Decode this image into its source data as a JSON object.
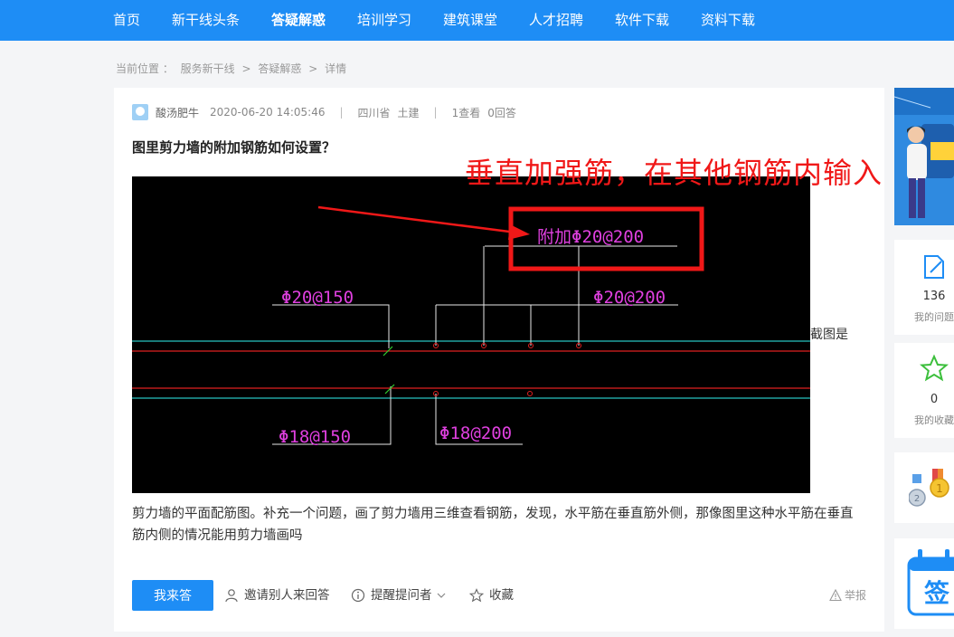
{
  "nav": {
    "items": [
      {
        "label": "首页",
        "active": false
      },
      {
        "label": "新干线头条",
        "active": false
      },
      {
        "label": "答疑解惑",
        "active": true
      },
      {
        "label": "培训学习",
        "active": false
      },
      {
        "label": "建筑课堂",
        "active": false
      },
      {
        "label": "人才招聘",
        "active": false
      },
      {
        "label": "软件下载",
        "active": false
      },
      {
        "label": "资料下载",
        "active": false
      }
    ]
  },
  "breadcrumb": {
    "prefix": "当前位置 ：",
    "items": [
      "服务新干线",
      "答疑解惑",
      "详情"
    ],
    "separator": ">"
  },
  "question": {
    "author": "酸汤肥牛",
    "datetime": "2020-06-20 14:05:46",
    "region": "四川省",
    "category": "土建",
    "views": "1查看",
    "answers": "0回答",
    "title": "图里剪力墙的附加钢筋如何设置？",
    "annotation": "垂直加强筋，在其他钢筋内输入",
    "side_text": "截图是",
    "body": "剪力墙的平面配筋图。补充一个问题，画了剪力墙用三维查看钢筋，发现，水平筋在垂直筋外侧，那像图里这种水平筋在垂直筋内侧的情况能用剪力墙画吗"
  },
  "cad": {
    "label_extra": "附加Φ20@200",
    "label_top_left": "Φ20@150",
    "label_top_right": "Φ20@200",
    "label_bottom_left": "Φ18@150",
    "label_bottom_right": "Φ18@200"
  },
  "actions": {
    "answer": "我来答",
    "invite": "邀请别人来回答",
    "remind": "提醒提问者",
    "favorite": "收藏",
    "report": "举报"
  },
  "sidebar": {
    "my_questions_count": "136",
    "my_questions_label": "我的问题",
    "my_favorites_count": "0",
    "my_favorites_label": "我的收藏",
    "sign_label": "签"
  },
  "colors": {
    "brand": "#1e8df5",
    "annotation_red": "#f01818",
    "cad_magenta": "#e040e0"
  }
}
